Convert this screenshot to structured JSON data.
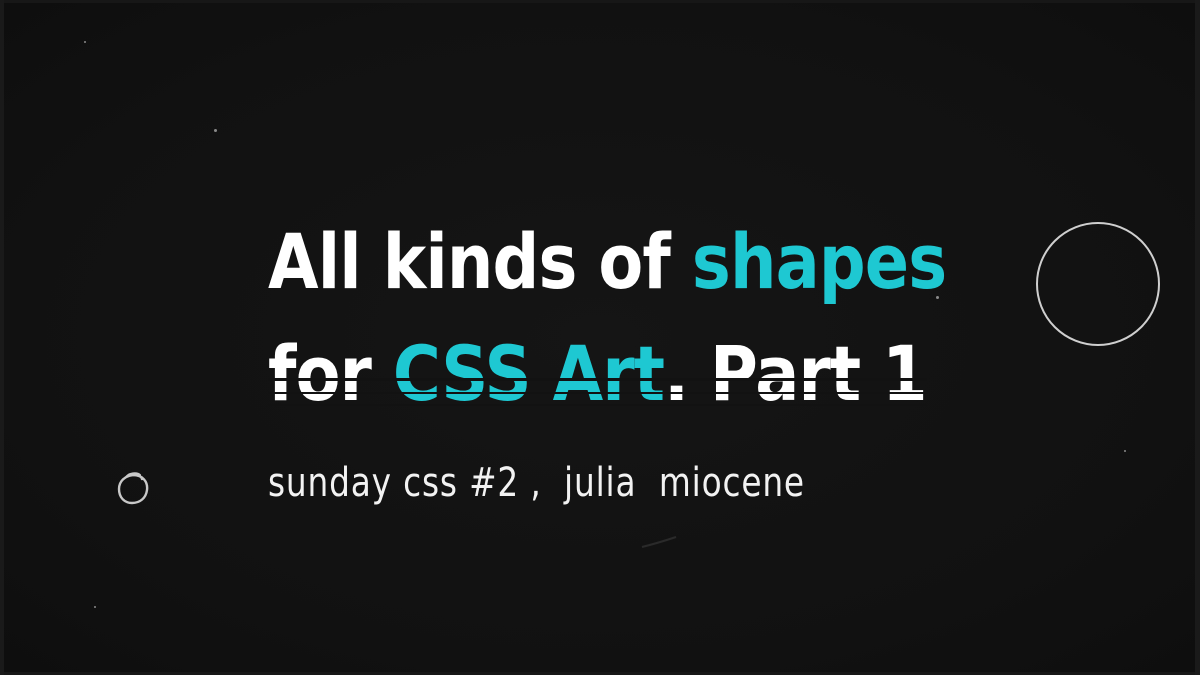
{
  "title": {
    "line1_plain": "All kinds of ",
    "line1_accent": "shapes",
    "line2_plain_a": "for ",
    "line2_accent": "CSS Art",
    "line2_plain_b": ". Part 1"
  },
  "subtitle": "sunday css #2 ,  julia  miocene",
  "colors": {
    "background": "#121212",
    "text": "#ffffff",
    "accent": "#1ec8d2",
    "ring": "#cfcfcf"
  },
  "icons": {
    "ring_large": "circle-outline",
    "ring_small": "scribbled-circle"
  }
}
